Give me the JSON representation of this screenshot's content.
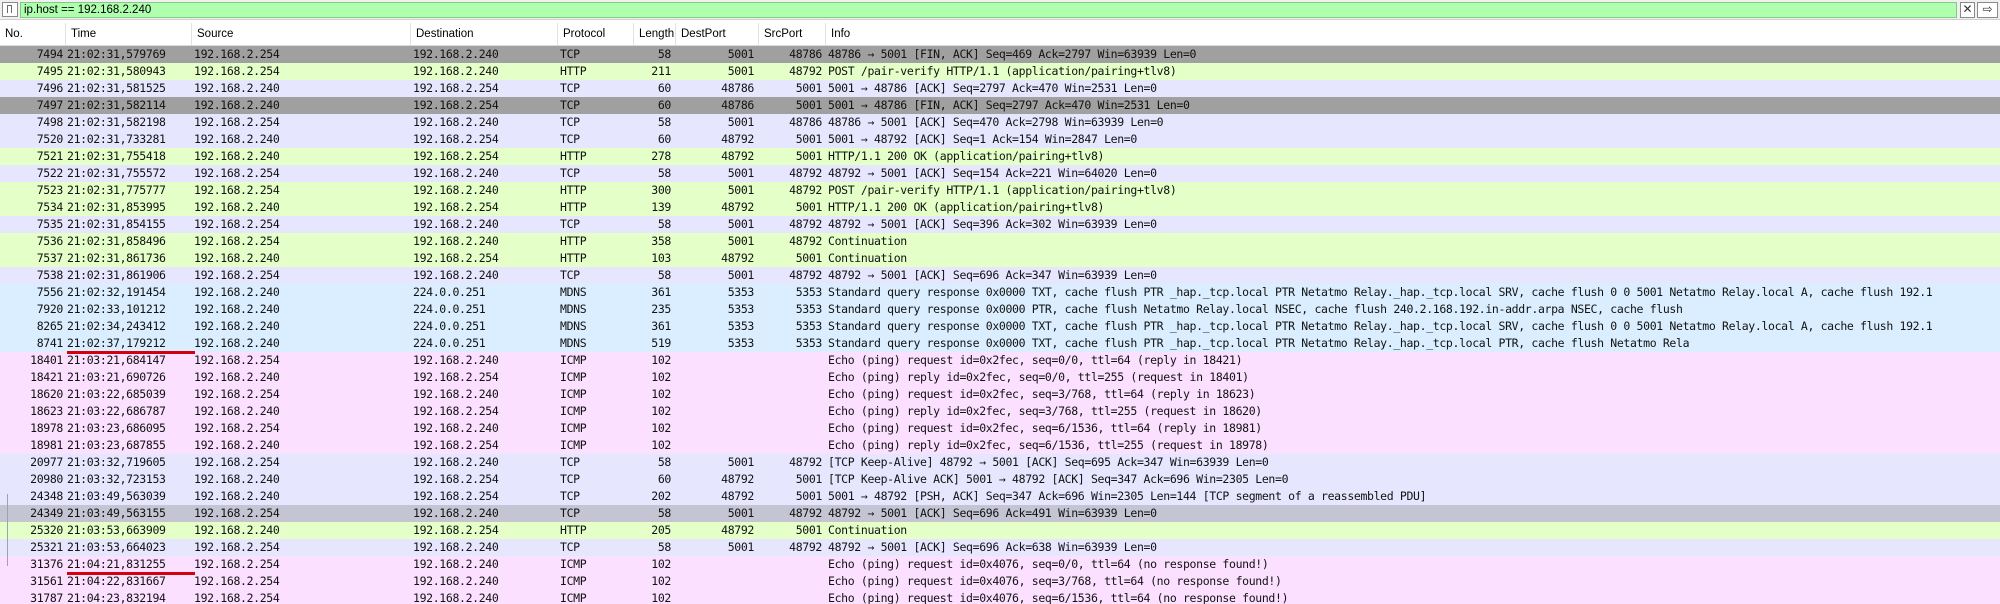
{
  "filter": {
    "value": "ip.host == 192.168.2.240",
    "clear_label": "✕",
    "apply_label": "⇨"
  },
  "colors": {
    "tcp": "#e7e6ff",
    "http": "#e4ffc7",
    "icmp": "#fce0ff",
    "mdns": "#daeeff",
    "fin": "#a0a0a0",
    "selected_marker": "#d4000b"
  },
  "columns": [
    "No.",
    "Time",
    "Source",
    "Destination",
    "Protocol",
    "Length",
    "DestPort",
    "SrcPort",
    "Info"
  ],
  "packets": [
    {
      "no": "7494",
      "time": "21:02:31,579769",
      "src": "192.168.2.254",
      "dst": "192.168.2.240",
      "proto": "TCP",
      "len": "58",
      "dport": "5001",
      "sport": "48786",
      "info": "48786 → 5001 [FIN, ACK] Seq=469 Ack=2797 Win=63939 Len=0",
      "color": "fin"
    },
    {
      "no": "7495",
      "time": "21:02:31,580943",
      "src": "192.168.2.254",
      "dst": "192.168.2.240",
      "proto": "HTTP",
      "len": "211",
      "dport": "5001",
      "sport": "48792",
      "info": "POST /pair-verify HTTP/1.1  (application/pairing+tlv8)",
      "color": "http"
    },
    {
      "no": "7496",
      "time": "21:02:31,581525",
      "src": "192.168.2.240",
      "dst": "192.168.2.254",
      "proto": "TCP",
      "len": "60",
      "dport": "48786",
      "sport": "5001",
      "info": "5001 → 48786 [ACK] Seq=2797 Ack=470 Win=2531 Len=0",
      "color": "tcp"
    },
    {
      "no": "7497",
      "time": "21:02:31,582114",
      "src": "192.168.2.240",
      "dst": "192.168.2.254",
      "proto": "TCP",
      "len": "60",
      "dport": "48786",
      "sport": "5001",
      "info": "5001 → 48786 [FIN, ACK] Seq=2797 Ack=470 Win=2531 Len=0",
      "color": "fin"
    },
    {
      "no": "7498",
      "time": "21:02:31,582198",
      "src": "192.168.2.254",
      "dst": "192.168.2.240",
      "proto": "TCP",
      "len": "58",
      "dport": "5001",
      "sport": "48786",
      "info": "48786 → 5001 [ACK] Seq=470 Ack=2798 Win=63939 Len=0",
      "color": "tcp"
    },
    {
      "no": "7520",
      "time": "21:02:31,733281",
      "src": "192.168.2.240",
      "dst": "192.168.2.254",
      "proto": "TCP",
      "len": "60",
      "dport": "48792",
      "sport": "5001",
      "info": "5001 → 48792 [ACK] Seq=1 Ack=154 Win=2847 Len=0",
      "color": "tcp"
    },
    {
      "no": "7521",
      "time": "21:02:31,755418",
      "src": "192.168.2.240",
      "dst": "192.168.2.254",
      "proto": "HTTP",
      "len": "278",
      "dport": "48792",
      "sport": "5001",
      "info": "HTTP/1.1 200 OK  (application/pairing+tlv8)",
      "color": "http"
    },
    {
      "no": "7522",
      "time": "21:02:31,755572",
      "src": "192.168.2.254",
      "dst": "192.168.2.240",
      "proto": "TCP",
      "len": "58",
      "dport": "5001",
      "sport": "48792",
      "info": "48792 → 5001 [ACK] Seq=154 Ack=221 Win=64020 Len=0",
      "color": "tcp"
    },
    {
      "no": "7523",
      "time": "21:02:31,775777",
      "src": "192.168.2.254",
      "dst": "192.168.2.240",
      "proto": "HTTP",
      "len": "300",
      "dport": "5001",
      "sport": "48792",
      "info": "POST /pair-verify HTTP/1.1  (application/pairing+tlv8)",
      "color": "http"
    },
    {
      "no": "7534",
      "time": "21:02:31,853995",
      "src": "192.168.2.240",
      "dst": "192.168.2.254",
      "proto": "HTTP",
      "len": "139",
      "dport": "48792",
      "sport": "5001",
      "info": "HTTP/1.1 200 OK  (application/pairing+tlv8)",
      "color": "http"
    },
    {
      "no": "7535",
      "time": "21:02:31,854155",
      "src": "192.168.2.254",
      "dst": "192.168.2.240",
      "proto": "TCP",
      "len": "58",
      "dport": "5001",
      "sport": "48792",
      "info": "48792 → 5001 [ACK] Seq=396 Ack=302 Win=63939 Len=0",
      "color": "tcp"
    },
    {
      "no": "7536",
      "time": "21:02:31,858496",
      "src": "192.168.2.254",
      "dst": "192.168.2.240",
      "proto": "HTTP",
      "len": "358",
      "dport": "5001",
      "sport": "48792",
      "info": "Continuation",
      "color": "http"
    },
    {
      "no": "7537",
      "time": "21:02:31,861736",
      "src": "192.168.2.240",
      "dst": "192.168.2.254",
      "proto": "HTTP",
      "len": "103",
      "dport": "48792",
      "sport": "5001",
      "info": "Continuation",
      "color": "http"
    },
    {
      "no": "7538",
      "time": "21:02:31,861906",
      "src": "192.168.2.254",
      "dst": "192.168.2.240",
      "proto": "TCP",
      "len": "58",
      "dport": "5001",
      "sport": "48792",
      "info": "48792 → 5001 [ACK] Seq=696 Ack=347 Win=63939 Len=0",
      "color": "tcp"
    },
    {
      "no": "7556",
      "time": "21:02:32,191454",
      "src": "192.168.2.240",
      "dst": "224.0.0.251",
      "proto": "MDNS",
      "len": "361",
      "dport": "5353",
      "sport": "5353",
      "info": "Standard query response 0x0000 TXT, cache flush PTR _hap._tcp.local PTR Netatmo Relay._hap._tcp.local SRV, cache flush 0 0 5001 Netatmo Relay.local A, cache flush 192.1",
      "color": "mdns"
    },
    {
      "no": "7920",
      "time": "21:02:33,101212",
      "src": "192.168.2.240",
      "dst": "224.0.0.251",
      "proto": "MDNS",
      "len": "235",
      "dport": "5353",
      "sport": "5353",
      "info": "Standard query response 0x0000 PTR, cache flush Netatmo Relay.local NSEC, cache flush 240.2.168.192.in-addr.arpa NSEC, cache flush",
      "color": "mdns"
    },
    {
      "no": "8265",
      "time": "21:02:34,243412",
      "src": "192.168.2.240",
      "dst": "224.0.0.251",
      "proto": "MDNS",
      "len": "361",
      "dport": "5353",
      "sport": "5353",
      "info": "Standard query response 0x0000 TXT, cache flush PTR _hap._tcp.local PTR Netatmo Relay._hap._tcp.local SRV, cache flush 0 0 5001 Netatmo Relay.local A, cache flush 192.1",
      "color": "mdns"
    },
    {
      "no": "8741",
      "time": "21:02:37,179212",
      "src": "192.168.2.240",
      "dst": "224.0.0.251",
      "proto": "MDNS",
      "len": "519",
      "dport": "5353",
      "sport": "5353",
      "info": "Standard query response 0x0000 TXT, cache flush PTR _hap._tcp.local PTR Netatmo Relay._hap._tcp.local PTR, cache flush Netatmo Rela",
      "color": "mdns"
    },
    {
      "no": "18401",
      "time": "21:03:21,684147",
      "src": "192.168.2.254",
      "dst": "192.168.2.240",
      "proto": "ICMP",
      "len": "102",
      "dport": "",
      "sport": "",
      "info": "Echo (ping) request  id=0x2fec, seq=0/0, ttl=64 (reply in 18421)",
      "color": "icmp"
    },
    {
      "no": "18421",
      "time": "21:03:21,690726",
      "src": "192.168.2.240",
      "dst": "192.168.2.254",
      "proto": "ICMP",
      "len": "102",
      "dport": "",
      "sport": "",
      "info": "Echo (ping) reply    id=0x2fec, seq=0/0, ttl=255 (request in 18401)",
      "color": "icmp"
    },
    {
      "no": "18620",
      "time": "21:03:22,685039",
      "src": "192.168.2.254",
      "dst": "192.168.2.240",
      "proto": "ICMP",
      "len": "102",
      "dport": "",
      "sport": "",
      "info": "Echo (ping) request  id=0x2fec, seq=3/768, ttl=64 (reply in 18623)",
      "color": "icmp"
    },
    {
      "no": "18623",
      "time": "21:03:22,686787",
      "src": "192.168.2.240",
      "dst": "192.168.2.254",
      "proto": "ICMP",
      "len": "102",
      "dport": "",
      "sport": "",
      "info": "Echo (ping) reply    id=0x2fec, seq=3/768, ttl=255 (request in 18620)",
      "color": "icmp"
    },
    {
      "no": "18978",
      "time": "21:03:23,686095",
      "src": "192.168.2.254",
      "dst": "192.168.2.240",
      "proto": "ICMP",
      "len": "102",
      "dport": "",
      "sport": "",
      "info": "Echo (ping) request  id=0x2fec, seq=6/1536, ttl=64 (reply in 18981)",
      "color": "icmp"
    },
    {
      "no": "18981",
      "time": "21:03:23,687855",
      "src": "192.168.2.240",
      "dst": "192.168.2.254",
      "proto": "ICMP",
      "len": "102",
      "dport": "",
      "sport": "",
      "info": "Echo (ping) reply    id=0x2fec, seq=6/1536, ttl=255 (request in 18978)",
      "color": "icmp"
    },
    {
      "no": "20977",
      "time": "21:03:32,719605",
      "src": "192.168.2.254",
      "dst": "192.168.2.240",
      "proto": "TCP",
      "len": "58",
      "dport": "5001",
      "sport": "48792",
      "info": "[TCP Keep-Alive] 48792 → 5001 [ACK] Seq=695 Ack=347 Win=63939 Len=0",
      "color": "tcp"
    },
    {
      "no": "20980",
      "time": "21:03:32,723153",
      "src": "192.168.2.240",
      "dst": "192.168.2.254",
      "proto": "TCP",
      "len": "60",
      "dport": "48792",
      "sport": "5001",
      "info": "[TCP Keep-Alive ACK] 5001 → 48792 [ACK] Seq=347 Ack=696 Win=2305 Len=0",
      "color": "tcp"
    },
    {
      "no": "24348",
      "time": "21:03:49,563039",
      "src": "192.168.2.240",
      "dst": "192.168.2.254",
      "proto": "TCP",
      "len": "202",
      "dport": "48792",
      "sport": "5001",
      "info": "5001 → 48792 [PSH, ACK] Seq=347 Ack=696 Win=2305 Len=144 [TCP segment of a reassembled PDU]",
      "color": "tcp"
    },
    {
      "no": "24349",
      "time": "21:03:49,563155",
      "src": "192.168.2.254",
      "dst": "192.168.2.240",
      "proto": "TCP",
      "len": "58",
      "dport": "5001",
      "sport": "48792",
      "info": "48792 → 5001 [ACK] Seq=696 Ack=491 Win=63939 Len=0",
      "color": "sel"
    },
    {
      "no": "25320",
      "time": "21:03:53,663909",
      "src": "192.168.2.240",
      "dst": "192.168.2.254",
      "proto": "HTTP",
      "len": "205",
      "dport": "48792",
      "sport": "5001",
      "info": "Continuation",
      "color": "http"
    },
    {
      "no": "25321",
      "time": "21:03:53,664023",
      "src": "192.168.2.254",
      "dst": "192.168.2.240",
      "proto": "TCP",
      "len": "58",
      "dport": "5001",
      "sport": "48792",
      "info": "48792 → 5001 [ACK] Seq=696 Ack=638 Win=63939 Len=0",
      "color": "tcp"
    },
    {
      "no": "31376",
      "time": "21:04:21,831255",
      "src": "192.168.2.254",
      "dst": "192.168.2.240",
      "proto": "ICMP",
      "len": "102",
      "dport": "",
      "sport": "",
      "info": "Echo (ping) request  id=0x4076, seq=0/0, ttl=64 (no response found!)",
      "color": "icmp"
    },
    {
      "no": "31561",
      "time": "21:04:22,831667",
      "src": "192.168.2.254",
      "dst": "192.168.2.240",
      "proto": "ICMP",
      "len": "102",
      "dport": "",
      "sport": "",
      "info": "Echo (ping) request  id=0x4076, seq=3/768, ttl=64 (no response found!)",
      "color": "icmp"
    },
    {
      "no": "31787",
      "time": "21:04:23,832194",
      "src": "192.168.2.254",
      "dst": "192.168.2.240",
      "proto": "ICMP",
      "len": "102",
      "dport": "",
      "sport": "",
      "info": "Echo (ping) request  id=0x4076, seq=6/1536, ttl=64 (no response found!)",
      "color": "icmp"
    }
  ]
}
